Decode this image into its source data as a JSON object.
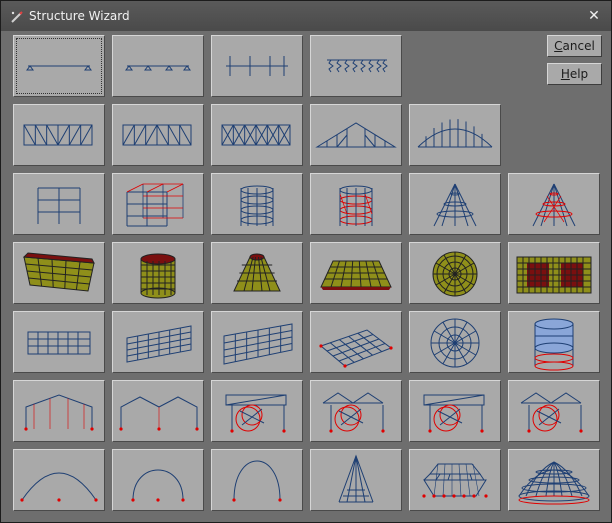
{
  "window": {
    "title": "Structure Wizard",
    "close_glyph": "✕",
    "icon": "wand-icon"
  },
  "buttons": {
    "cancel": {
      "accel": "C",
      "rest": "ancel"
    },
    "help": {
      "accel": "H",
      "rest": "elp"
    }
  },
  "tiles": [
    [
      "continuous-beam",
      "multi-span-beam",
      "portal-frame",
      "beam-on-springs",
      "",
      ""
    ],
    [
      "pratt-truss",
      "howe-truss",
      "x-braced-truss",
      "roof-truss",
      "bowstring-truss",
      ""
    ],
    [
      "2d-frame",
      "3d-frame",
      "cylindrical-frame",
      "cylindrical-frame-braced",
      "conical-frame",
      "conical-frame-braced"
    ],
    [
      "box-surface",
      "cylinder-surface",
      "cone-surface",
      "trapezoid-surface",
      "circular-plate",
      "plate-with-openings"
    ],
    [
      "flat-grid",
      "skewed-grid",
      "inclined-grid",
      "warped-grid",
      "polar-grid",
      "tank"
    ],
    [
      "gable-frame",
      "multi-gable-frame",
      "pipe-rack-frame",
      "pipe-rack-gable",
      "pipe-rack-frame-2",
      "pipe-rack-gable-2"
    ],
    [
      "parabolic-arch",
      "circular-arch",
      "elliptic-arch",
      "tower",
      "space-truss",
      "dome"
    ]
  ],
  "colors": {
    "line": "#1e3f73",
    "support": "#e00000",
    "fill": "#8f8f1a",
    "fill_dark": "#7a0f0f",
    "tank": "#8aa6d8"
  }
}
